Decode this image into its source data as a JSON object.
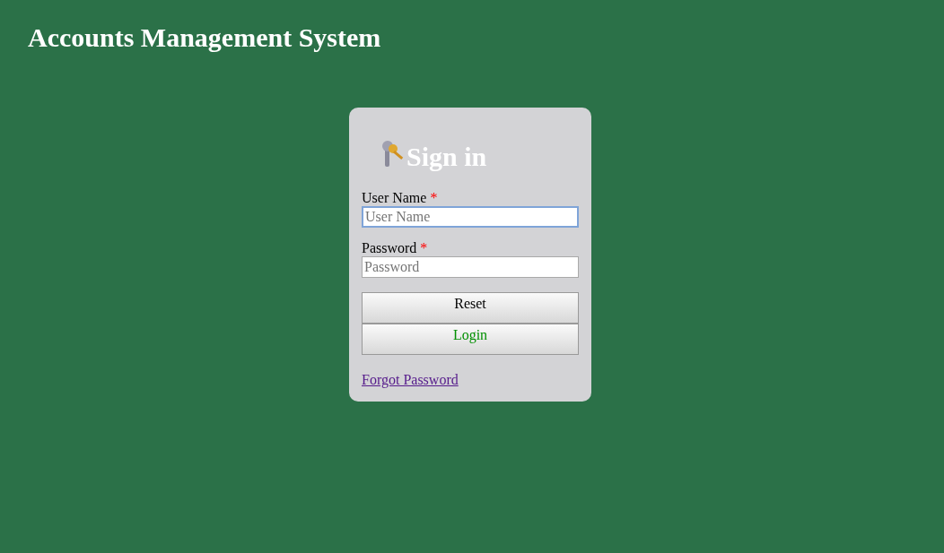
{
  "page_title": "Accounts Management System",
  "login": {
    "heading": "Sign in",
    "fields": [
      {
        "label": "User Name",
        "required_mark": "*",
        "placeholder": "User Name",
        "focused": true
      },
      {
        "label": "Password",
        "required_mark": "*",
        "placeholder": "Password",
        "focused": false
      }
    ],
    "buttons": [
      {
        "label": "Reset",
        "kind": "reset"
      },
      {
        "label": "Login",
        "kind": "submit"
      }
    ],
    "link": "Forgot Password"
  }
}
